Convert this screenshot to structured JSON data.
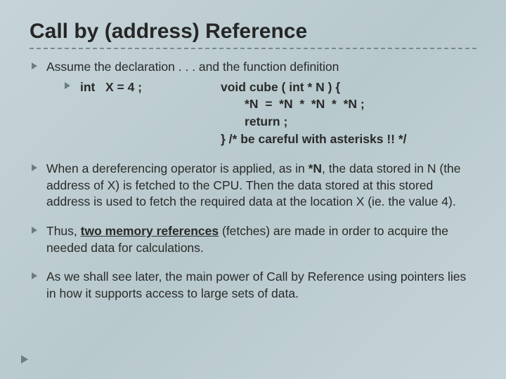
{
  "title": "Call by (address) Reference",
  "bullets": {
    "b1_intro": "Assume the declaration . . . and the function definition",
    "decl": "int   X = 4 ;",
    "func_l1": "void cube ( int * N ) {",
    "func_l2": "       *N  =  *N  *  *N  *  *N ;",
    "func_l3": "       return ;",
    "func_l4": "} /* be careful with asterisks !! */",
    "b2_a": "When a dereferencing operator is applied, as in ",
    "b2_starN": "*N",
    "b2_b": ", the data stored in N (the address of X) is fetched to the CPU.  Then the data stored at this stored address is used to fetch the required data at the location X (ie. the value 4).",
    "b3_a": "Thus, ",
    "b3_u": "two memory references",
    "b3_b": " (fetches) are made in order to acquire the needed data for calculations.",
    "b4": "As we shall see later, the main power of Call by Reference using pointers lies in how it supports access to large sets of data."
  }
}
